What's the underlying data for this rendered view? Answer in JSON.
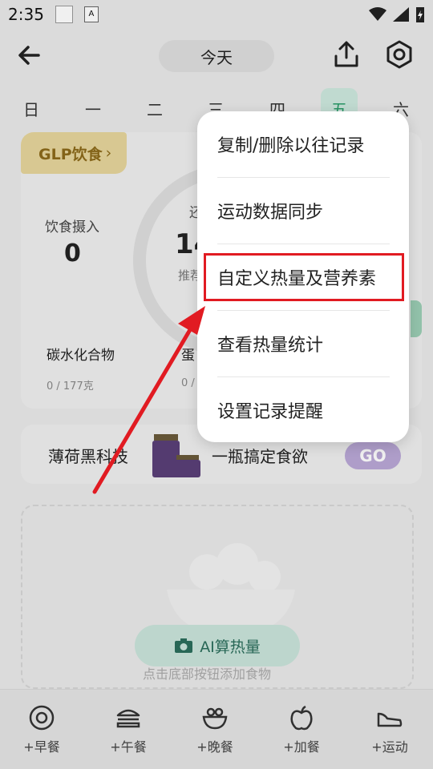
{
  "status": {
    "time": "2:35"
  },
  "header": {
    "title": "今天"
  },
  "weekdays": [
    "日",
    "一",
    "二",
    "三",
    "四",
    "五",
    "六"
  ],
  "card": {
    "tag": "GLP饮食",
    "intake_label": "饮食摄入",
    "intake_value": "0",
    "ring_top": "还",
    "ring_value": "14",
    "ring_sub": "推荐",
    "carb_label": "碳水化合物",
    "carb_value": "0 / 177克",
    "protein_label": "蛋",
    "protein_value": "0 / "
  },
  "ad": {
    "left_text": "薄荷黑科技",
    "right_text": "一瓶搞定食欲",
    "go": "GO"
  },
  "empty": {
    "ai_label": "AI算热量",
    "hint": "点击底部按钮添加食物"
  },
  "tabs": [
    {
      "label": "+早餐",
      "icon": "breakfast-icon"
    },
    {
      "label": "+午餐",
      "icon": "burger-icon"
    },
    {
      "label": "+晚餐",
      "icon": "bowl-icon"
    },
    {
      "label": "+加餐",
      "icon": "apple-icon"
    },
    {
      "label": "+运动",
      "icon": "shoe-icon"
    }
  ],
  "menu": {
    "items": [
      "复制/删除以往记录",
      "运动数据同步",
      "自定义热量及营养素",
      "查看热量统计",
      "设置记录提醒"
    ]
  },
  "colors": {
    "accent": "#2a9d6a",
    "highlight": "#e11b22",
    "arrow": "#e11b22"
  }
}
